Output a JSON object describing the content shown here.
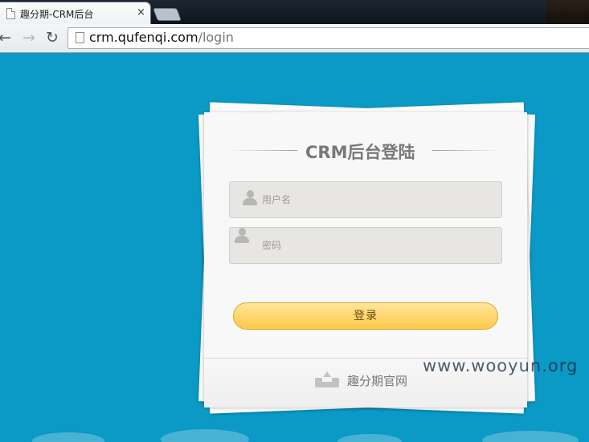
{
  "browser": {
    "tab_title": "趣分期-CRM后台",
    "tab_close": "×",
    "url_host": "crm.qufenqi.com",
    "url_path": "/login",
    "back_glyph": "←",
    "forward_glyph": "→",
    "reload_glyph": "↻"
  },
  "login": {
    "title": "CRM后台登陆",
    "username_placeholder": "用户名",
    "password_placeholder": "密码",
    "submit_label": "登录",
    "footer_link": "趣分期官网"
  },
  "colors": {
    "page_background": "#0b99c6",
    "button": "#ffc84a"
  },
  "watermark": "www.wooyun.org"
}
